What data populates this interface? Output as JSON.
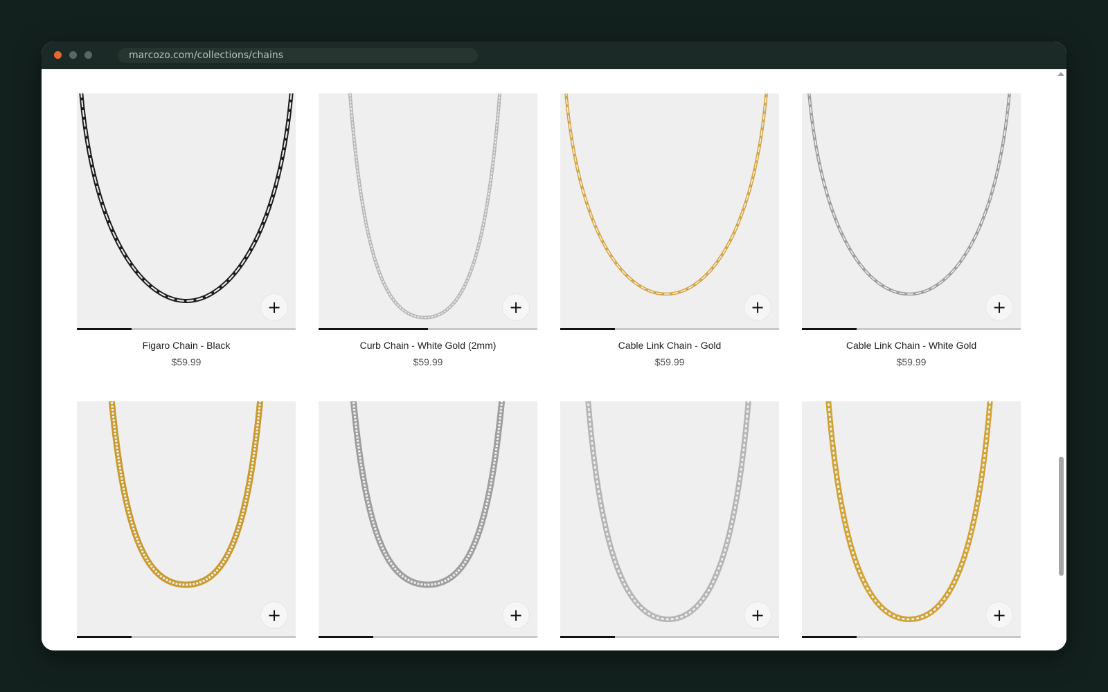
{
  "browser": {
    "url": "marcozo.com/collections/chains"
  },
  "products": [
    {
      "name": "Figaro Chain - Black",
      "price": "$59.99",
      "image_color": "#1c1c1c",
      "chain_style": "figaro",
      "gallery_progress": 0.25
    },
    {
      "name": "Curb Chain - White Gold (2mm)",
      "price": "$59.99",
      "image_color": "#b8b8b8",
      "chain_style": "curb-thin",
      "gallery_progress": 0.5
    },
    {
      "name": "Cable Link Chain - Gold",
      "price": "$59.99",
      "image_color": "#d4a542",
      "chain_style": "cable",
      "gallery_progress": 0.25
    },
    {
      "name": "Cable Link Chain - White Gold",
      "price": "$59.99",
      "image_color": "#9c9c9c",
      "chain_style": "cable",
      "gallery_progress": 0.25
    },
    {
      "name": "",
      "price": "",
      "image_color": "#c99a2e",
      "chain_style": "curb",
      "gallery_progress": 0.25
    },
    {
      "name": "",
      "price": "",
      "image_color": "#9e9e9e",
      "chain_style": "curb",
      "gallery_progress": 0.25
    },
    {
      "name": "",
      "price": "",
      "image_color": "#b5b5b5",
      "chain_style": "box",
      "gallery_progress": 0.25
    },
    {
      "name": "",
      "price": "",
      "image_color": "#d1a234",
      "chain_style": "box",
      "gallery_progress": 0.25
    }
  ],
  "add_button": {
    "icon": "plus-icon",
    "glyph": "+"
  }
}
